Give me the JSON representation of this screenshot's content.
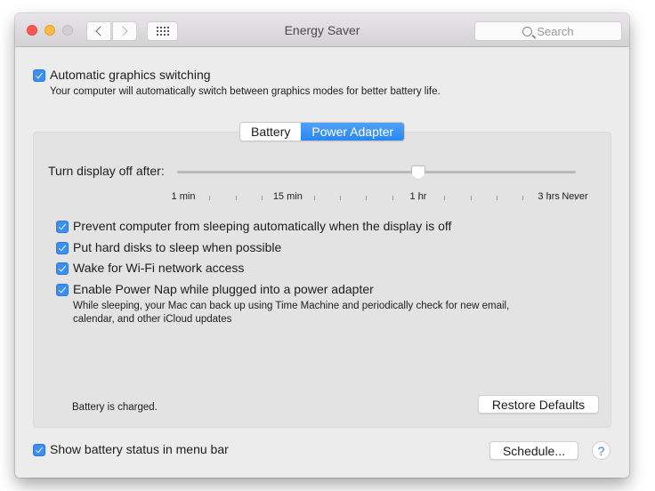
{
  "window": {
    "title": "Energy Saver",
    "search_placeholder": "Search"
  },
  "graphics": {
    "label": "Automatic graphics switching",
    "checked": true,
    "description": "Your computer will automatically switch between graphics modes for better battery life."
  },
  "tabs": [
    {
      "label": "Battery",
      "active": false
    },
    {
      "label": "Power Adapter",
      "active": true
    }
  ],
  "slider": {
    "label": "Turn display off after:",
    "value": "1 hr",
    "tick_count": 16,
    "value_tick_index": 9,
    "tick_labels": [
      {
        "text": "1 min",
        "tick": 0
      },
      {
        "text": "15 min",
        "tick": 4
      },
      {
        "text": "1 hr",
        "tick": 9
      },
      {
        "text": "3 hrs",
        "tick": 14
      },
      {
        "text": "Never",
        "tick": 15
      }
    ]
  },
  "options": [
    {
      "label": "Prevent computer from sleeping automatically when the display is off",
      "checked": true
    },
    {
      "label": "Put hard disks to sleep when possible",
      "checked": true
    },
    {
      "label": "Wake for Wi-Fi network access",
      "checked": true
    },
    {
      "label": "Enable Power Nap while plugged into a power adapter",
      "checked": true
    }
  ],
  "power_nap_description": "While sleeping, your Mac can back up using Time Machine and periodically check for new email, calendar, and other iCloud updates",
  "battery_status": "Battery is charged.",
  "restore_defaults_label": "Restore Defaults",
  "show_battery": {
    "label": "Show battery status in menu bar",
    "checked": true
  },
  "schedule_label": "Schedule...",
  "help_label": "?",
  "colors": {
    "accent": "#3b8ef5"
  }
}
